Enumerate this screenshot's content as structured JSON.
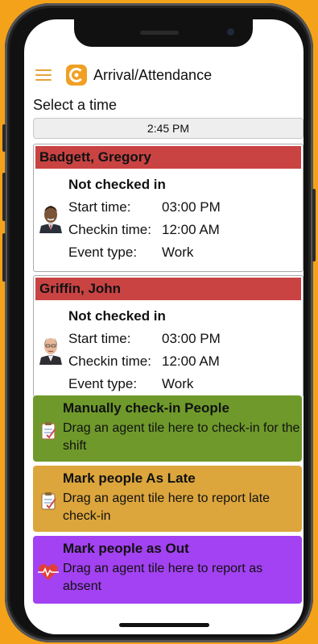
{
  "app": {
    "title": "Arrival/Attendance",
    "menu_icon": "hamburger-menu-icon",
    "logo_icon": "app-logo-icon"
  },
  "select": {
    "label": "Select a time",
    "value": "2:45 PM"
  },
  "labels": {
    "start": "Start time:",
    "checkin": "Checkin time:",
    "event": "Event type:"
  },
  "agents": [
    {
      "name": "Badgett, Gregory",
      "status": "Not checked in",
      "start_time": "03:00 PM",
      "checkin_time": "12:00 AM",
      "event_type": "Work"
    },
    {
      "name": "Griffin, John",
      "status": "Not checked in",
      "start_time": "03:00 PM",
      "checkin_time": "12:00 AM",
      "event_type": "Work"
    }
  ],
  "drop_zones": [
    {
      "title": "Manually check-in People",
      "desc": "Drag an agent tile here to check-in for the shift",
      "color": "#6f9a2b",
      "icon": "clipboard-check-icon"
    },
    {
      "title": "Mark people As Late",
      "desc": "Drag an agent tile here to report late check-in",
      "color": "#dca63d",
      "icon": "clipboard-check-icon"
    },
    {
      "title": "Mark people as Out",
      "desc": "Drag an agent tile here to report as absent",
      "color": "#a342f2",
      "icon": "heart-pulse-icon"
    }
  ],
  "colors": {
    "background": "#f5a21b",
    "card_header": "#c94343",
    "accent": "#f0a024"
  }
}
